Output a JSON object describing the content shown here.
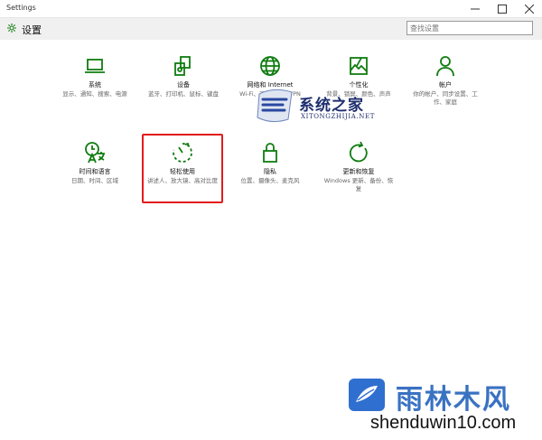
{
  "window": {
    "title": "Settings"
  },
  "header": {
    "title": "设置"
  },
  "search": {
    "placeholder": "查找设置"
  },
  "tiles": [
    {
      "name": "系统",
      "desc": "显示、通知、搜索、电源",
      "icon": "laptop-icon"
    },
    {
      "name": "设备",
      "desc": "蓝牙、打印机、鼠标、键盘",
      "icon": "devices-icon"
    },
    {
      "name": "网络和 Internet",
      "desc": "Wi-Fi、飞行模式、VPN",
      "icon": "globe-icon"
    },
    {
      "name": "个性化",
      "desc": "背景、锁屏、颜色、声声",
      "icon": "personalization-icon"
    },
    {
      "name": "帐户",
      "desc": "你的帐户、同步设置、工作、家庭",
      "icon": "person-icon"
    },
    {
      "name": "时间和语言",
      "desc": "日期、时间、区域",
      "icon": "time-language-icon"
    },
    {
      "name": "轻松使用",
      "desc": "讲述人、放大镜、高对比度",
      "icon": "ease-of-access-icon"
    },
    {
      "name": "隐私",
      "desc": "位置、摄像头、麦克风",
      "icon": "lock-icon"
    },
    {
      "name": "更新和恢复",
      "desc": "Windows 更新、备份、恢复",
      "icon": "refresh-icon"
    }
  ],
  "watermarks": {
    "top": {
      "name": "系统之家",
      "url": "XITONGZHIJIA.NET"
    },
    "bottom": {
      "name": "雨林木风",
      "url": "shenduwin10.com"
    }
  },
  "colors": {
    "accent": "#107c10",
    "highlight": "#e21b1b"
  }
}
